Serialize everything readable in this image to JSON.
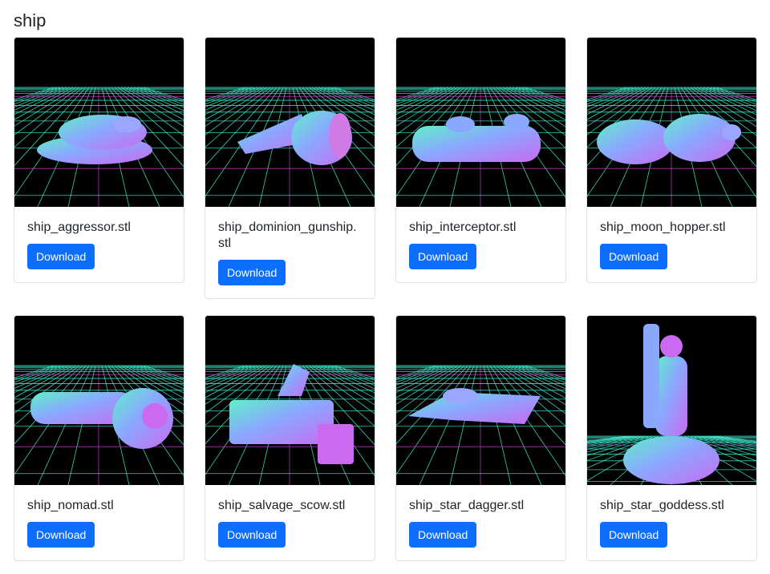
{
  "page": {
    "title": "ship"
  },
  "theme": {
    "accent": "#0d6efd",
    "grid_cyan": "#3ff5d6",
    "grid_magenta": "#c93bd6",
    "card_border": "#dee2e6"
  },
  "cards": [
    {
      "filename": "ship_aggressor.stl",
      "button_label": "Download",
      "icon": "ship-model-thumbnail"
    },
    {
      "filename": "ship_dominion_gunship.stl",
      "button_label": "Download",
      "icon": "ship-model-thumbnail"
    },
    {
      "filename": "ship_interceptor.stl",
      "button_label": "Download",
      "icon": "ship-model-thumbnail"
    },
    {
      "filename": "ship_moon_hopper.stl",
      "button_label": "Download",
      "icon": "ship-model-thumbnail"
    },
    {
      "filename": "ship_nomad.stl",
      "button_label": "Download",
      "icon": "ship-model-thumbnail"
    },
    {
      "filename": "ship_salvage_scow.stl",
      "button_label": "Download",
      "icon": "ship-model-thumbnail"
    },
    {
      "filename": "ship_star_dagger.stl",
      "button_label": "Download",
      "icon": "ship-model-thumbnail"
    },
    {
      "filename": "ship_star_goddess.stl",
      "button_label": "Download",
      "icon": "ship-model-thumbnail"
    }
  ]
}
